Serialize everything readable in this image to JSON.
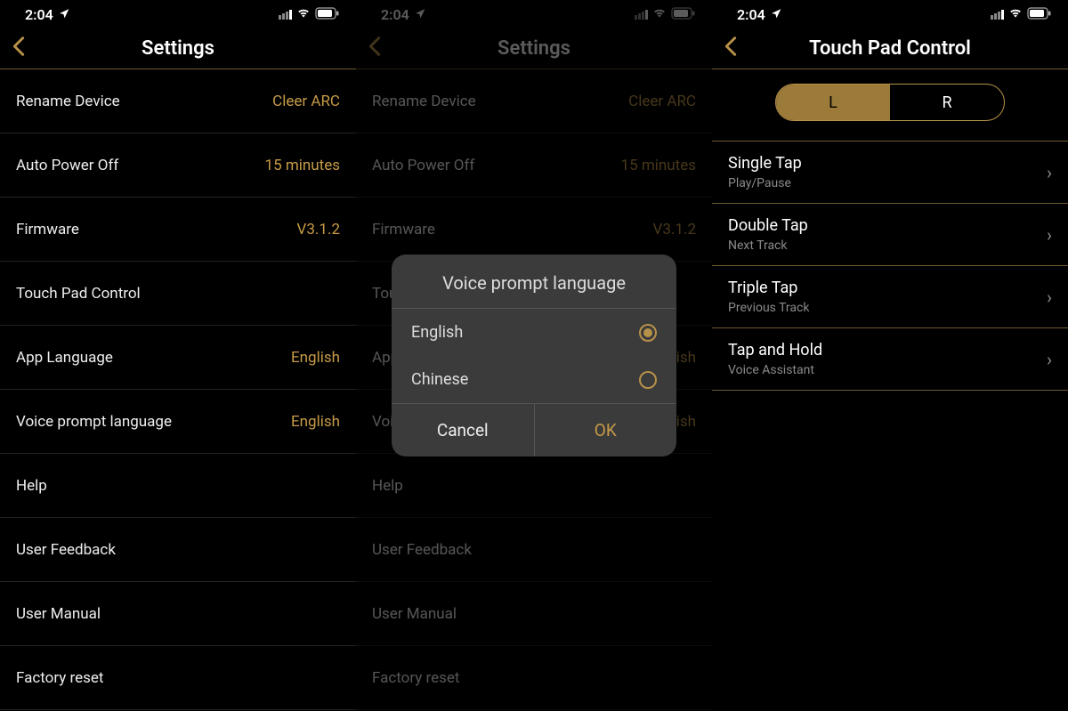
{
  "statusBar": {
    "time": "2:04"
  },
  "screen1": {
    "title": "Settings",
    "rows": [
      {
        "label": "Rename Device",
        "value": "Cleer ARC"
      },
      {
        "label": "Auto Power Off",
        "value": "15 minutes"
      },
      {
        "label": "Firmware",
        "value": "V3.1.2"
      },
      {
        "label": "Touch Pad Control",
        "value": ""
      },
      {
        "label": "App Language",
        "value": "English"
      },
      {
        "label": "Voice prompt language",
        "value": "English"
      },
      {
        "label": "Help",
        "value": ""
      },
      {
        "label": "User Feedback",
        "value": ""
      },
      {
        "label": "User Manual",
        "value": ""
      },
      {
        "label": "Factory reset",
        "value": ""
      }
    ]
  },
  "screen2": {
    "title": "Settings",
    "modal": {
      "title": "Voice prompt language",
      "options": [
        {
          "label": "English",
          "selected": true
        },
        {
          "label": "Chinese",
          "selected": false
        }
      ],
      "cancel": "Cancel",
      "ok": "OK"
    }
  },
  "screen3": {
    "title": "Touch Pad Control",
    "segments": {
      "left": "L",
      "right": "R",
      "active": "L"
    },
    "rows": [
      {
        "title": "Single Tap",
        "sub": "Play/Pause"
      },
      {
        "title": "Double Tap",
        "sub": "Next Track"
      },
      {
        "title": "Triple Tap",
        "sub": "Previous Track"
      },
      {
        "title": "Tap and Hold",
        "sub": "Voice Assistant"
      }
    ]
  }
}
